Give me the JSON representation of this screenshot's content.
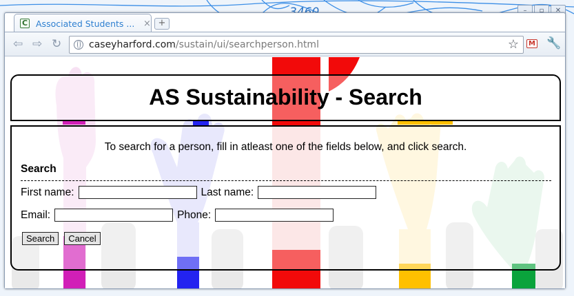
{
  "browser": {
    "tab_title": "Associated Students ...",
    "tab_close": "×",
    "newtab": "+",
    "favicon": "C",
    "url_host": "caseyharford.com",
    "url_path": "/sustain/ui/searchperson.html",
    "topo_text": "3460"
  },
  "page": {
    "title": "AS Sustainability - Search",
    "intro": "To search for a person, fill in atleast one of the fields below, and click search.",
    "section_heading": "Search",
    "fields": {
      "first_name_label": "First name:",
      "last_name_label": "Last name:",
      "email_label": "Email:",
      "phone_label": "Phone:"
    },
    "buttons": {
      "search": "Search",
      "cancel": "Cancel"
    }
  },
  "colors": {
    "hand_magenta": "#d11fb7",
    "hand_blue": "#2323f0",
    "hand_red": "#f20a0a",
    "hand_yellow": "#ffc000",
    "hand_green": "#0aa33c"
  }
}
